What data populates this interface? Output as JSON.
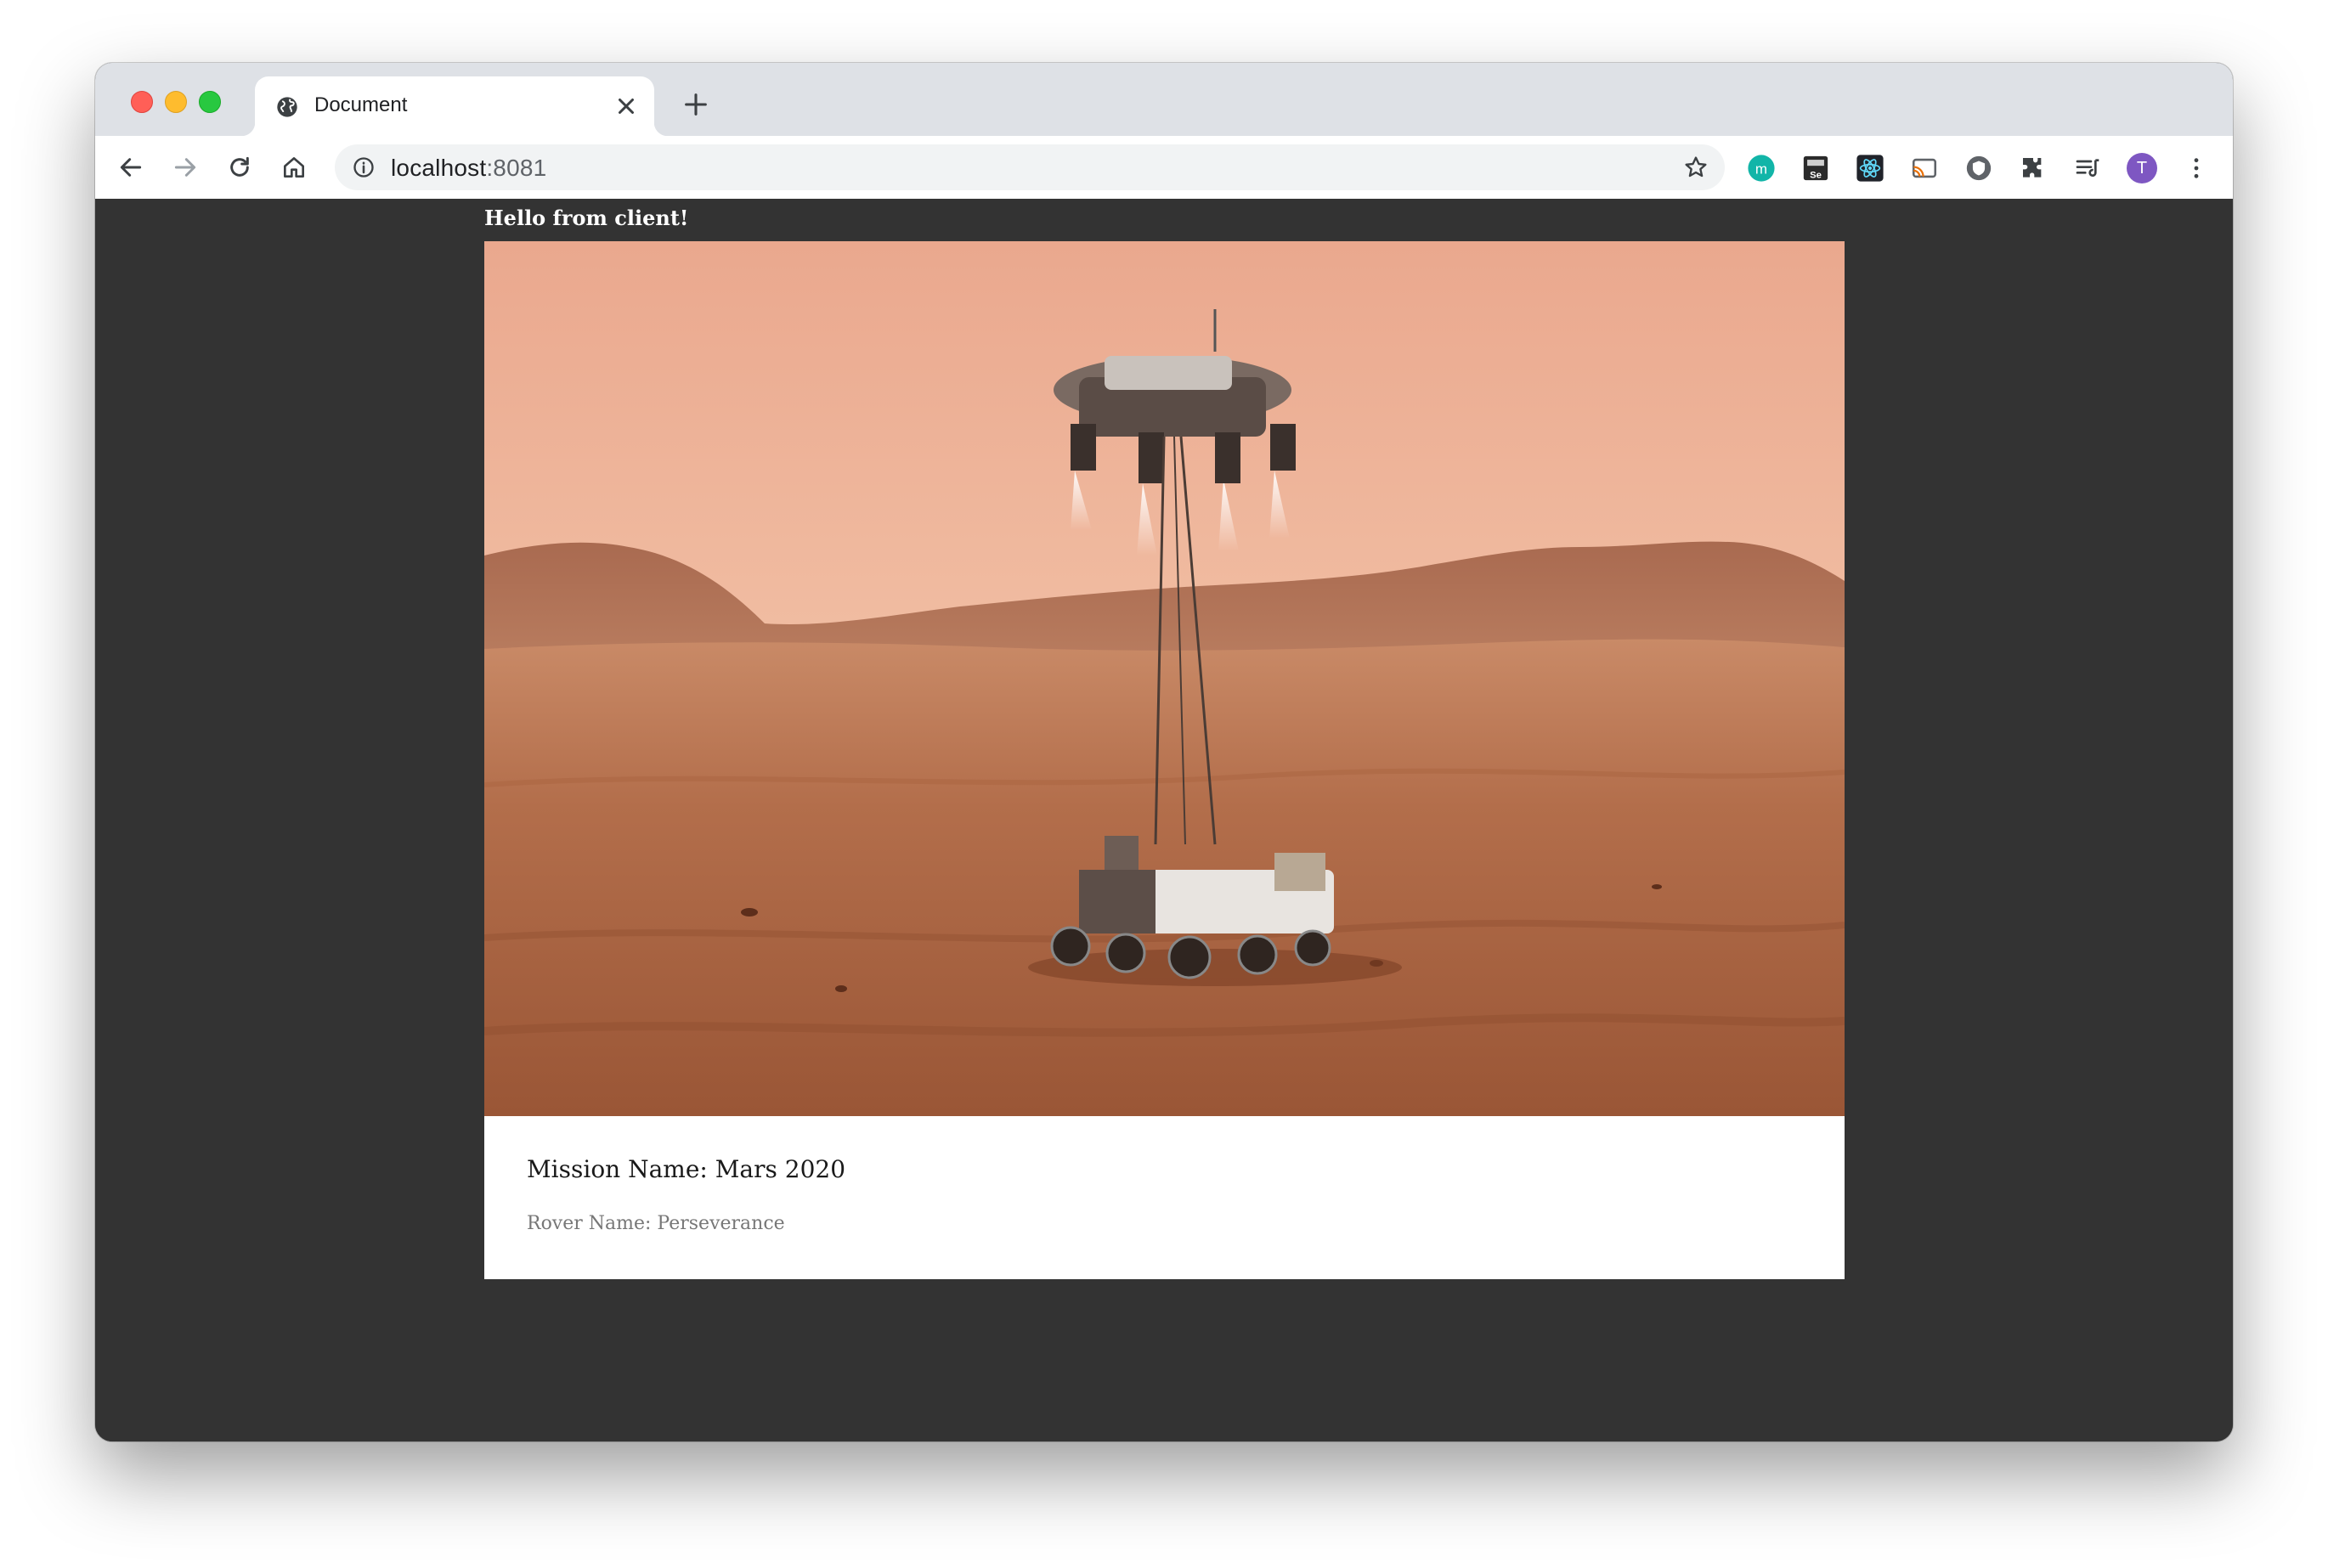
{
  "browser": {
    "tab": {
      "title": "Document"
    },
    "address_bar": {
      "host": "localhost",
      "port": ":8081"
    },
    "profile_initial": "T",
    "extensions": [
      "monica-icon",
      "selenium-icon",
      "react-devtools-icon",
      "cast-icon",
      "privacy-badger-icon",
      "extensions-puzzle-icon",
      "reading-list-icon"
    ]
  },
  "page": {
    "greeting": "Hello from client!",
    "card": {
      "mission_label": "Mission Name: Mars 2020",
      "rover_label": "Rover Name: Perseverance",
      "image_description": "Perseverance rover being lowered by sky crane onto Martian terrain"
    }
  },
  "colors": {
    "page_background": "#333333",
    "card_background": "#ffffff",
    "tabstrip": "#dee1e6",
    "profile_avatar": "#7e57c2"
  }
}
